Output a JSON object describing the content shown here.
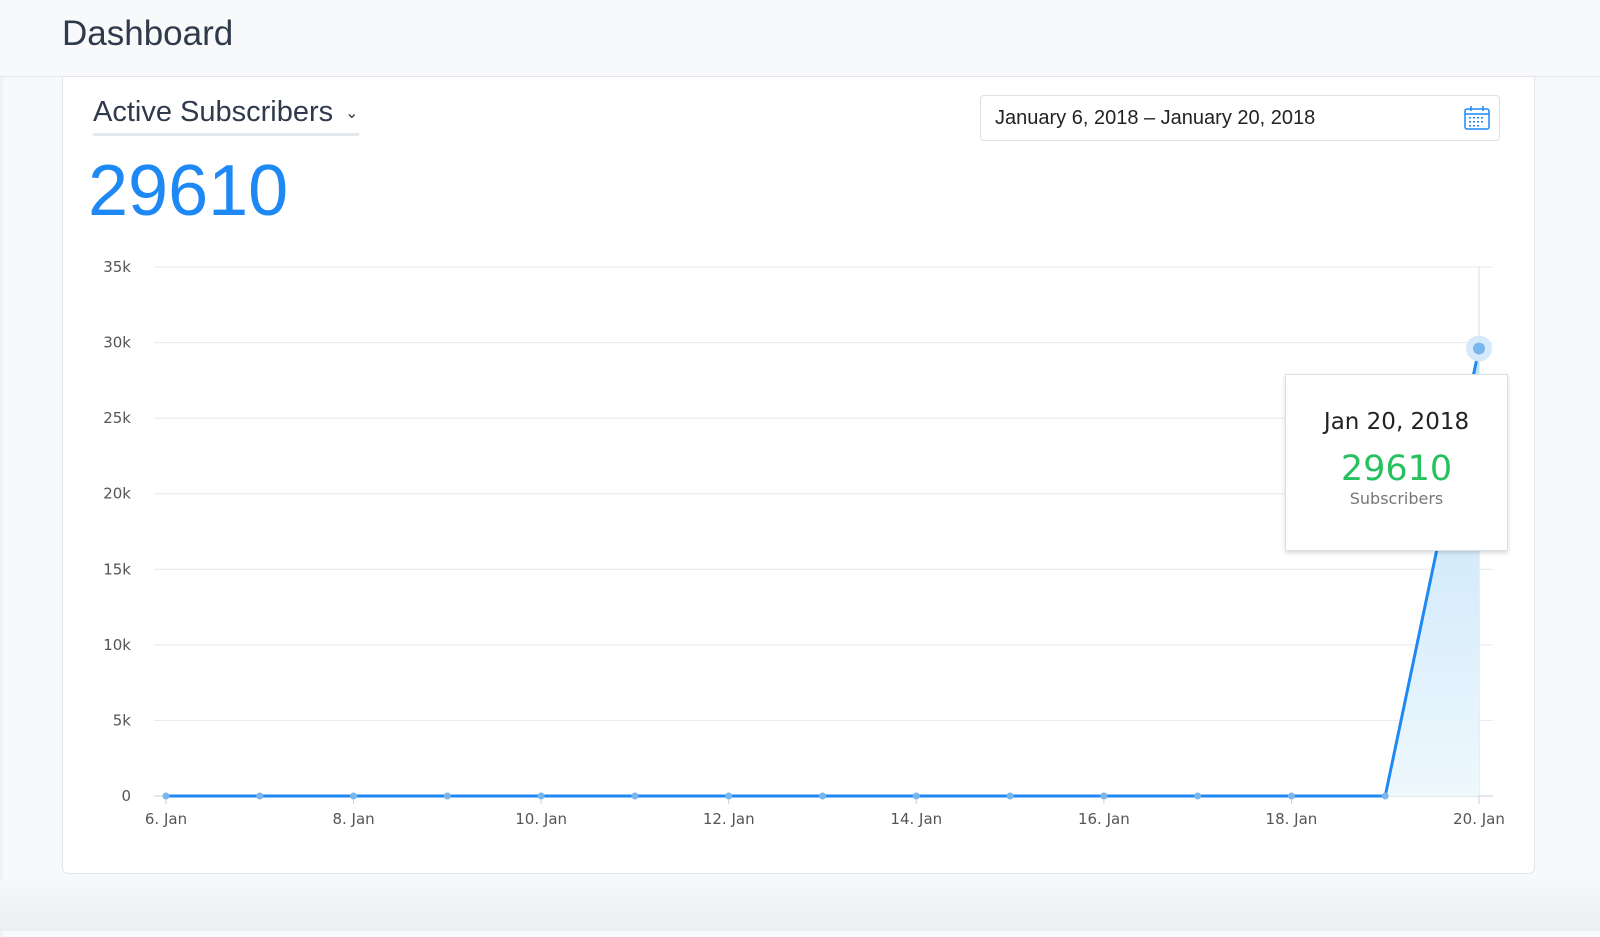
{
  "header": {
    "title": "Dashboard"
  },
  "metric": {
    "selected": "Active Subscribers",
    "value": "29610"
  },
  "date_range": {
    "value": "January 6, 2018 – January 20, 2018"
  },
  "tooltip": {
    "date": "Jan 20, 2018",
    "value": "29610",
    "label": "Subscribers"
  },
  "colors": {
    "accent": "#1e88f5",
    "tooltip_value": "#27c15f"
  },
  "chart_data": {
    "type": "area",
    "x": [
      "6. Jan",
      "7. Jan",
      "8. Jan",
      "9. Jan",
      "10. Jan",
      "11. Jan",
      "12. Jan",
      "13. Jan",
      "14. Jan",
      "15. Jan",
      "16. Jan",
      "17. Jan",
      "18. Jan",
      "19. Jan",
      "20. Jan"
    ],
    "xticks": [
      "6. Jan",
      "8. Jan",
      "10. Jan",
      "12. Jan",
      "14. Jan",
      "16. Jan",
      "18. Jan",
      "20. Jan"
    ],
    "series": [
      {
        "name": "Subscribers",
        "values": [
          0,
          0,
          0,
          0,
          0,
          0,
          0,
          0,
          0,
          0,
          0,
          0,
          0,
          0,
          29610
        ]
      }
    ],
    "yticks": [
      "0",
      "5k",
      "10k",
      "15k",
      "20k",
      "25k",
      "30k",
      "35k"
    ],
    "ylim": [
      0,
      35000
    ],
    "grid": true,
    "legend": "none"
  }
}
